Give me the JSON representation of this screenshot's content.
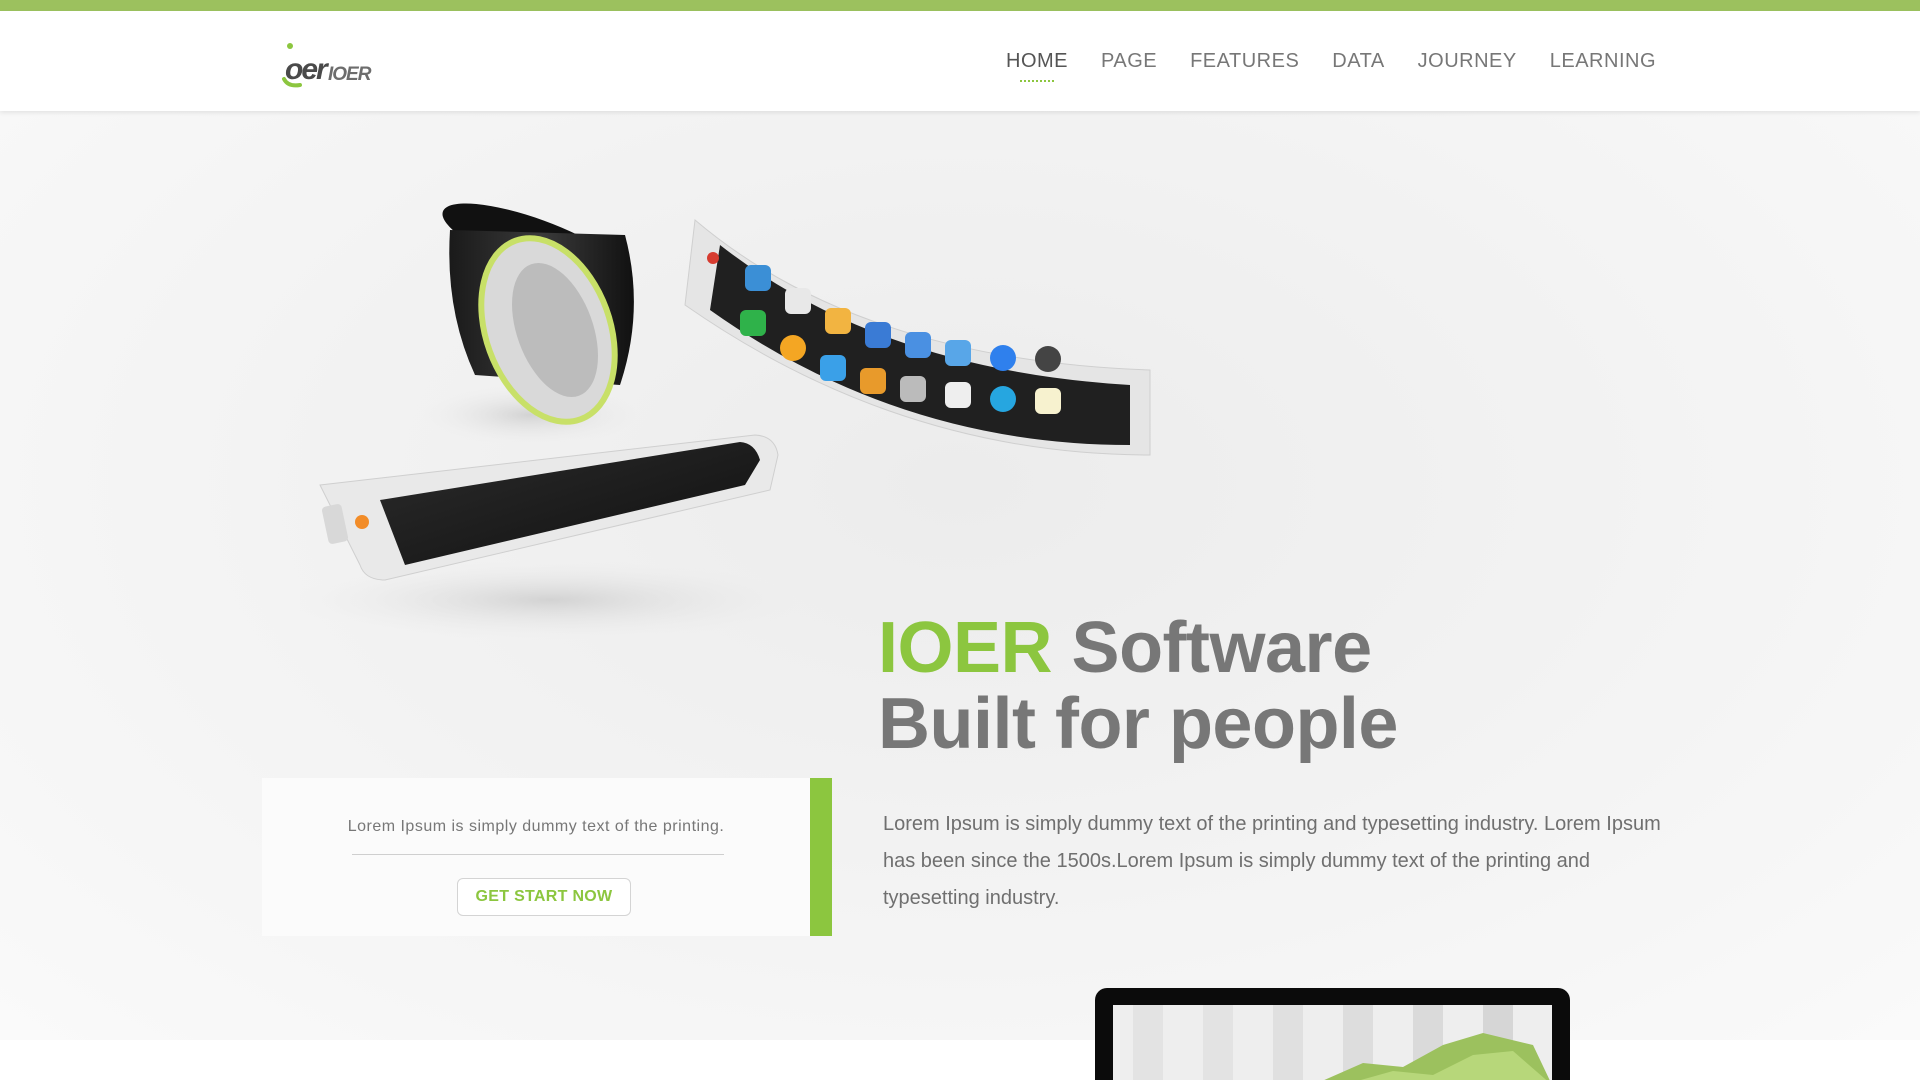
{
  "brand": {
    "logo_text": "IOER",
    "accent_color": "#8cc63f",
    "top_bar_color": "#9cc15e"
  },
  "nav": {
    "items": [
      {
        "label": "HOME",
        "active": true
      },
      {
        "label": "PAGE",
        "active": false
      },
      {
        "label": "FEATURES",
        "active": false
      },
      {
        "label": "DATA",
        "active": false
      },
      {
        "label": "JOURNEY",
        "active": false
      },
      {
        "label": "LEARNING",
        "active": false
      }
    ]
  },
  "hero": {
    "headline_accent": "IOER",
    "headline_rest": "Software",
    "headline_line2": "Built for people",
    "images": [
      "flexible-bracelet-device",
      "curved-phone-with-app-icons",
      "flat-tablet-device"
    ]
  },
  "cta": {
    "text": "Lorem Ipsum is simply dummy text of the printing.",
    "button_label": "GET START NOW"
  },
  "description": "Lorem Ipsum is simply dummy text of the printing and typesetting industry. Lorem Ipsum has been since the 1500s.Lorem Ipsum is simply dummy text of the printing and typesetting industry.",
  "preview": {
    "image": "monitor-with-area-chart"
  }
}
